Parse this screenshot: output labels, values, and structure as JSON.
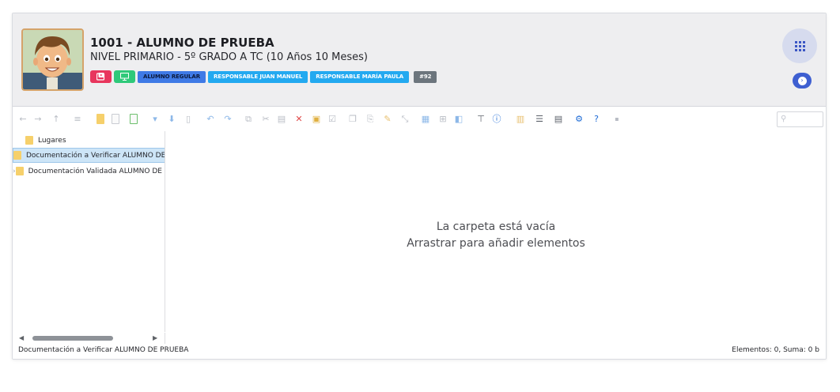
{
  "student": {
    "title": "1001 - ALUMNO DE PRUEBA",
    "subtitle": "NIVEL PRIMARIO - 5º GRADO A TC (10 Años 10 Meses)",
    "badges": [
      "ALUMNO REGULAR",
      "RESPONSABLE JUAN MANUEL",
      "RESPONSABLE MARÍA PAULA",
      "#92"
    ]
  },
  "colors": {
    "red_button": "#e8365d",
    "green_button": "#2fc97a",
    "regular_badge": "#3f7ae6",
    "responsable_badge": "#23a9f0",
    "number_badge": "#6c757d",
    "accent": "#3e5fd1"
  },
  "icons": {
    "video": "video-icon",
    "monitor": "monitor-icon",
    "apps": "apps-grid-icon",
    "go": "arrow-right-circle-icon"
  },
  "explorer": {
    "tree": [
      {
        "label": "Lugares",
        "selected": false,
        "expander": ""
      },
      {
        "label": "Documentación a Verificar ALUMNO DE PRUEBA",
        "selected": true,
        "expander": ""
      },
      {
        "label": "Documentación Validada ALUMNO DE PRUEBA",
        "selected": false,
        "expander": "›"
      }
    ],
    "empty_line1": "La carpeta está vacía",
    "empty_line2": "Arrastrar para añadir elementos",
    "status_path": "Documentación a Verificar ALUMNO DE PRUEBA",
    "status_summary": "Elementos: 0, Suma: 0 b"
  }
}
